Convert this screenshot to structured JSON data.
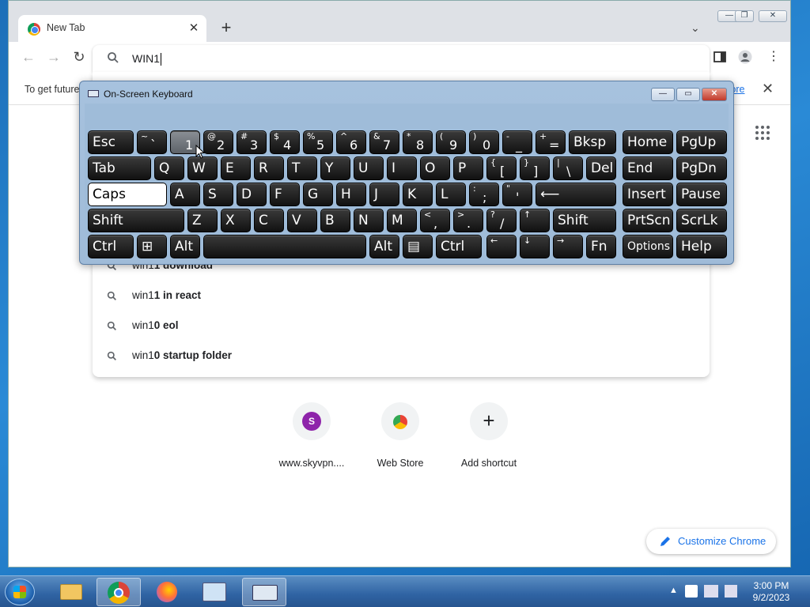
{
  "browser": {
    "tab_title": "New Tab",
    "omnibox_value": "WIN1",
    "infobar_message": "To get future",
    "infobar_link": "more",
    "window_controls": [
      "minimize-icon",
      "restore-icon",
      "close-icon"
    ]
  },
  "suggestions": [
    {
      "prefix": "win1",
      "suffix": "1 download"
    },
    {
      "prefix": "win1",
      "suffix": "1 in react"
    },
    {
      "prefix": "win1",
      "suffix": "0 eol"
    },
    {
      "prefix": "win1",
      "suffix": "0 startup folder"
    }
  ],
  "shortcuts": [
    {
      "label": "www.skyvpn....",
      "initial": "S"
    },
    {
      "label": "Web Store"
    },
    {
      "label": "Add shortcut"
    }
  ],
  "customize_label": "Customize Chrome",
  "osk": {
    "title": "On-Screen Keyboard",
    "keys": {
      "esc": "Esc",
      "tilde_u": "~",
      "tilde_l": "`",
      "n1": "1",
      "n2_u": "@",
      "n2": "2",
      "n3_u": "#",
      "n3": "3",
      "n4_u": "$",
      "n4": "4",
      "n5_u": "%",
      "n5": "5",
      "n6_u": "^",
      "n6": "6",
      "n7_u": "&",
      "n7": "7",
      "n8_u": "*",
      "n8": "8",
      "n9_u": "(",
      "n9": "9",
      "n0_u": ")",
      "n0": "0",
      "minus_u": "-",
      "minus": "_",
      "plus_u": "+",
      "plus": "=",
      "bksp": "Bksp",
      "home": "Home",
      "pgup": "PgUp",
      "tab": "Tab",
      "q": "Q",
      "w": "W",
      "e": "E",
      "r": "R",
      "t": "T",
      "y": "Y",
      "u": "U",
      "i": "I",
      "o": "O",
      "p": "P",
      "lbr_u": "{",
      "lbr": "[",
      "rbr_u": "}",
      "rbr": "]",
      "bsl_u": "|",
      "bsl": "\\",
      "del": "Del",
      "end": "End",
      "pgdn": "PgDn",
      "caps": "Caps",
      "a": "A",
      "s": "S",
      "d": "D",
      "f": "F",
      "g": "G",
      "h": "H",
      "j": "J",
      "k": "K",
      "l": "L",
      "semi_u": ":",
      "semi": ";",
      "quote_u": "\"",
      "quote": "'",
      "enter": "⟵",
      "insert": "Insert",
      "pause": "Pause",
      "shift": "Shift",
      "z": "Z",
      "x": "X",
      "c": "C",
      "v": "V",
      "b": "B",
      "n": "N",
      "m": "M",
      "comma_u": "<",
      "comma": ",",
      "period_u": ">",
      "period": ".",
      "slash_u": "?",
      "slash": "/",
      "up": "↑",
      "shift_r": "Shift",
      "prtscn": "PrtScn",
      "scrlk": "ScrLk",
      "ctrl": "Ctrl",
      "alt": "Alt",
      "alt_r": "Alt",
      "ctrl_r": "Ctrl",
      "left": "←",
      "down": "↓",
      "right": "→",
      "fn": "Fn",
      "options": "Options",
      "help": "Help"
    }
  },
  "taskbar": {
    "time": "3:00 PM",
    "date": "9/2/2023"
  }
}
